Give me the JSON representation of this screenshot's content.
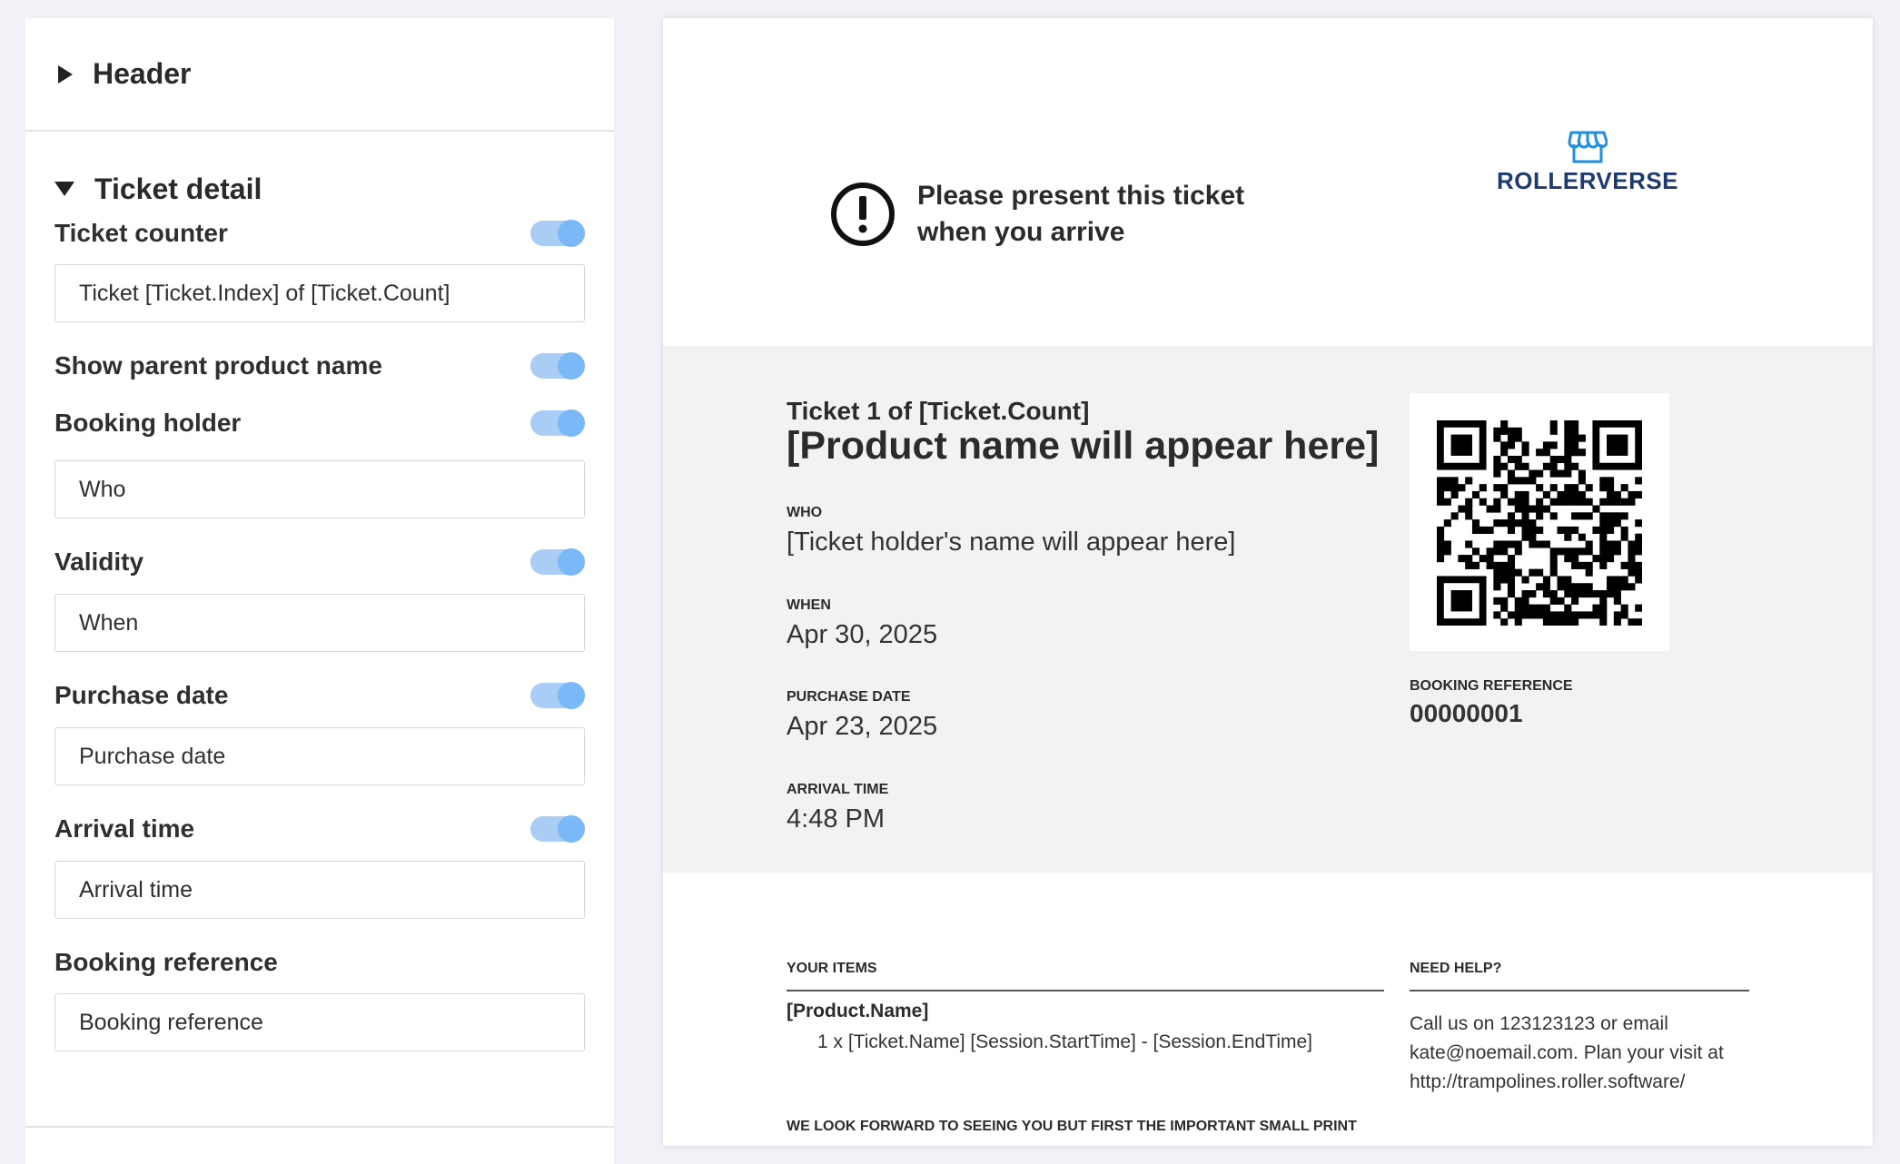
{
  "settings": {
    "header_section": "Header",
    "ticket_detail_section": "Ticket detail",
    "fields": [
      {
        "label": "Ticket counter",
        "enabled": true,
        "input_value": "Ticket [Ticket.Index] of [Ticket.Count]"
      },
      {
        "label": "Show parent product name",
        "enabled": true
      },
      {
        "label": "Booking holder",
        "enabled": true,
        "input_value": "Who"
      },
      {
        "label": "Validity",
        "enabled": true,
        "input_value": "When"
      },
      {
        "label": "Purchase date",
        "enabled": true,
        "input_value": "Purchase date"
      },
      {
        "label": "Arrival time",
        "enabled": true,
        "input_value": "Arrival time"
      },
      {
        "label": "Booking reference",
        "input_value": "Booking reference"
      }
    ]
  },
  "ticket": {
    "notice_text": "Please present this ticket when you arrive",
    "notice_line1": "Please present this ticket",
    "notice_line2": "when you arrive",
    "brand": "ROLLERVERSE",
    "counter": "Ticket 1 of [Ticket.Count]",
    "product_name": "[Product name will appear here]",
    "who_label": "WHO",
    "who_value": "[Ticket holder's name will appear here]",
    "when_label": "WHEN",
    "when_value": "Apr 30, 2025",
    "purchase_label": "PURCHASE DATE",
    "purchase_value": "Apr 23, 2025",
    "arrival_label": "ARRIVAL TIME",
    "arrival_value": "4:48 PM",
    "booking_ref_label": "BOOKING REFERENCE",
    "booking_ref_value": "00000001",
    "items_heading": "YOUR ITEMS",
    "items_product": "[Product.Name]",
    "items_line": "1 x [Ticket.Name] [Session.StartTime] - [Session.EndTime]",
    "help_heading": "NEED HELP?",
    "help_text": "Call us on 123123123 or email kate@noemail.com. Plan your visit at http://trampolines.roller.software/",
    "small_print": "WE LOOK FORWARD TO SEEING YOU BUT FIRST THE IMPORTANT SMALL PRINT"
  },
  "colors": {
    "toggle_track": "#a9cdf5",
    "toggle_knob": "#7ab8f7",
    "brand_text": "#1e3a70",
    "brand_icon": "#1e8fe0",
    "ticket_band": "#f2f2f2"
  },
  "icons": [
    "caret-right-icon",
    "caret-down-icon",
    "alert-circle-icon",
    "storefront-icon",
    "qr-code"
  ]
}
